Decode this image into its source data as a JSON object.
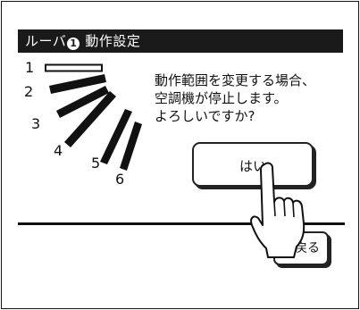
{
  "title_bar": {
    "prefix": "ルーバ",
    "badge": "1",
    "title": "動作設定"
  },
  "louver": {
    "positions": [
      "1",
      "2",
      "3",
      "4",
      "5",
      "6"
    ],
    "selected_position": "1"
  },
  "message": {
    "line1": "動作範囲を変更する場合、",
    "line2": "空調機が停止します。",
    "line3": "よろしいですか?"
  },
  "buttons": {
    "yes_label": "はい",
    "back_label": "戻る"
  },
  "icons": {
    "pointer": "hand-pointer-icon"
  },
  "colors": {
    "title_bar_bg": "#1a1a1a",
    "title_bar_text": "#ffffff",
    "line": "#111111"
  }
}
